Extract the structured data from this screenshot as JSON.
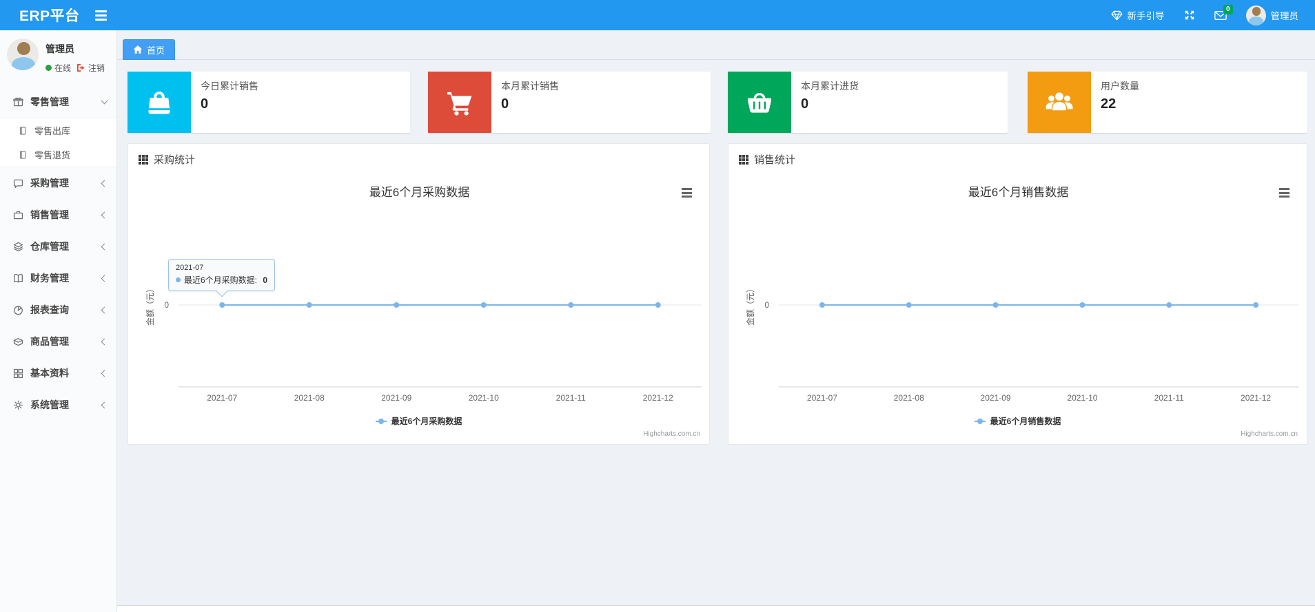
{
  "navbar": {
    "brand": "ERP平台",
    "guide_label": "新手引导",
    "mail_badge": "0",
    "username": "管理员",
    "color": "#2298f1",
    "icons": [
      "menu-burger-icon",
      "gem-icon",
      "fullscreen-icon",
      "envelope-icon",
      "avatar"
    ]
  },
  "sidebar": {
    "username": "管理员",
    "status_online": "在线",
    "logout_label": "注销",
    "items": [
      {
        "id": "retail",
        "icon": "gift-icon",
        "label": "零售管理",
        "expanded": true,
        "children": [
          {
            "id": "retail-out",
            "icon": "file-icon",
            "label": "零售出库"
          },
          {
            "id": "retail-return",
            "icon": "file-icon",
            "label": "零售退货"
          }
        ]
      },
      {
        "id": "purchase",
        "icon": "chat-icon",
        "label": "采购管理"
      },
      {
        "id": "sales",
        "icon": "briefcase-icon",
        "label": "销售管理"
      },
      {
        "id": "warehouse",
        "icon": "layers-icon",
        "label": "仓库管理"
      },
      {
        "id": "finance",
        "icon": "book-icon",
        "label": "财务管理"
      },
      {
        "id": "report",
        "icon": "pie-icon",
        "label": "报表查询"
      },
      {
        "id": "goods",
        "icon": "box-icon",
        "label": "商品管理"
      },
      {
        "id": "basic",
        "icon": "grid-icon",
        "label": "基本资料"
      },
      {
        "id": "system",
        "icon": "gear-icon",
        "label": "系统管理"
      }
    ]
  },
  "tabs": [
    {
      "label": "首页",
      "icon": "home-icon",
      "active": true
    }
  ],
  "cards": [
    {
      "title": "今日累计销售",
      "value": "0",
      "color": "#00c0ef",
      "icon": "shopping-bag-icon"
    },
    {
      "title": "本月累计销售",
      "value": "0",
      "color": "#dd4b39",
      "icon": "shopping-cart-icon"
    },
    {
      "title": "本月累计进货",
      "value": "0",
      "color": "#00a65a",
      "icon": "shopping-basket-icon"
    },
    {
      "title": "用户数量",
      "value": "22",
      "color": "#f39c12",
      "icon": "users-icon"
    }
  ],
  "panels": [
    {
      "header": "采购统计",
      "header_icon": "th-icon",
      "chart": 0,
      "has_tooltip": true
    },
    {
      "header": "销售统计",
      "header_icon": "th-icon",
      "chart": 1,
      "has_tooltip": false
    }
  ],
  "chart_data": [
    {
      "type": "line",
      "title": "最近6个月采购数据",
      "categories": [
        "2021-07",
        "2021-08",
        "2021-09",
        "2021-10",
        "2021-11",
        "2021-12"
      ],
      "series": [
        {
          "name": "最近6个月采购数据",
          "values": [
            0,
            0,
            0,
            0,
            0,
            0
          ]
        }
      ],
      "xlabel": "",
      "ylabel": "金额（元）",
      "yticks": [
        "0"
      ],
      "grid": "zero-line-only",
      "legend_position": "bottom",
      "line_color": "#7cb5ec",
      "credit": "Highcharts.com.cn"
    },
    {
      "type": "line",
      "title": "最近6个月销售数据",
      "categories": [
        "2021-07",
        "2021-08",
        "2021-09",
        "2021-10",
        "2021-11",
        "2021-12"
      ],
      "series": [
        {
          "name": "最近6个月销售数据",
          "values": [
            0,
            0,
            0,
            0,
            0,
            0
          ]
        }
      ],
      "xlabel": "",
      "ylabel": "金额（元）",
      "yticks": [
        "0"
      ],
      "grid": "zero-line-only",
      "legend_position": "bottom",
      "line_color": "#7cb5ec",
      "credit": "Highcharts.com.cn"
    }
  ],
  "tooltip": {
    "header": "2021-07",
    "series": "最近6个月采购数据",
    "value": "0"
  }
}
